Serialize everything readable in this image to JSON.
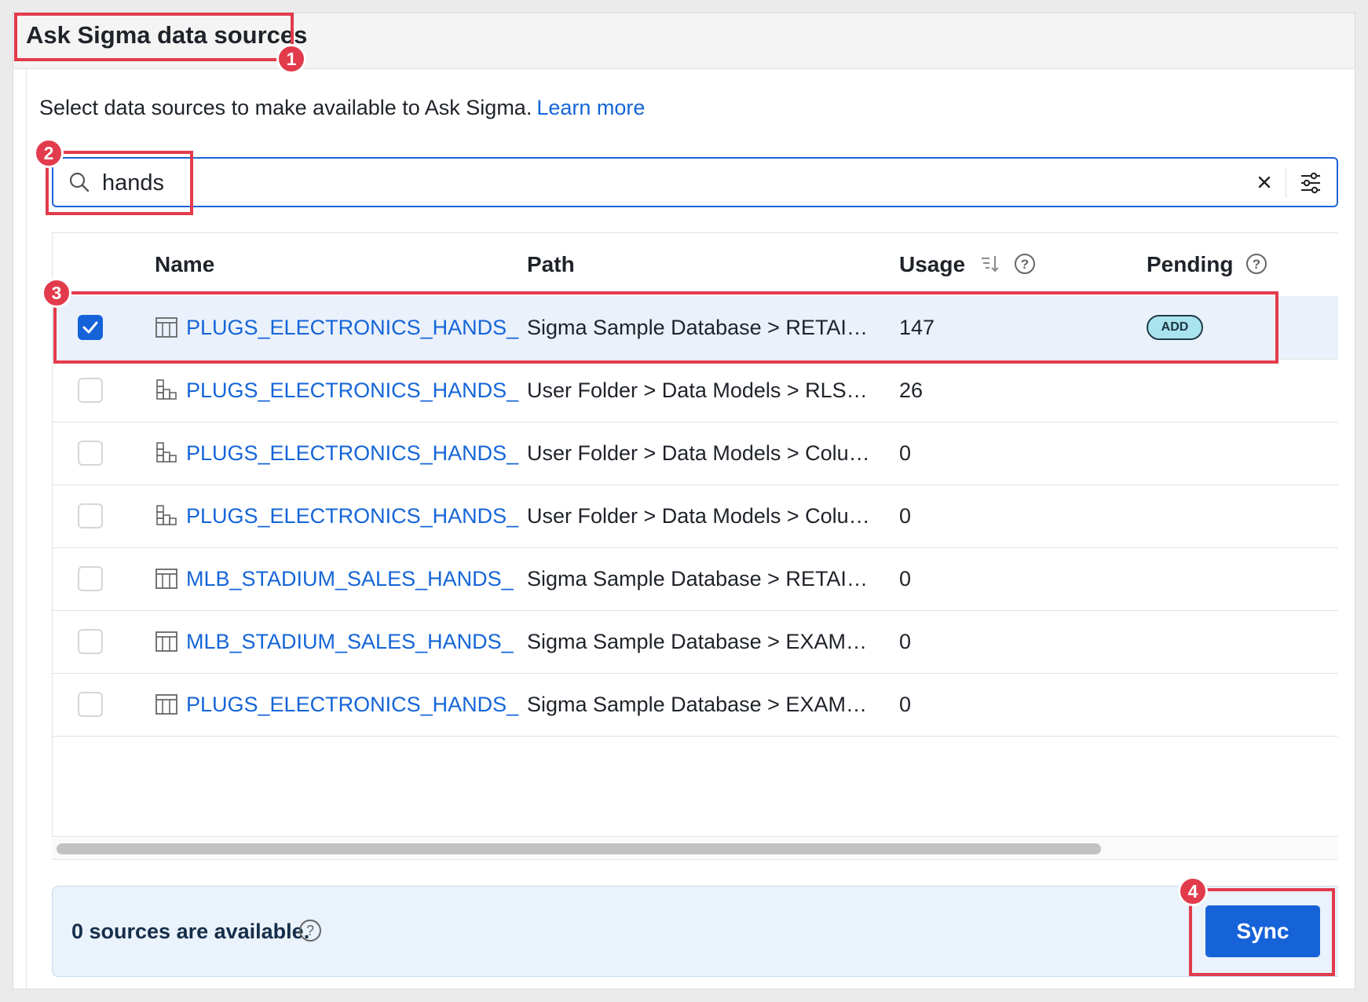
{
  "panel": {
    "title": "Ask Sigma data sources",
    "intro_text": "Select data sources to make available to Ask Sigma.",
    "learn_more": "Learn more"
  },
  "search": {
    "value": "hands",
    "icon": "search-icon",
    "clear_icon": "close-icon",
    "filter_icon": "sliders-icon"
  },
  "table": {
    "columns": {
      "name": "Name",
      "path": "Path",
      "usage": "Usage",
      "pending": "Pending"
    },
    "rows": [
      {
        "selected": true,
        "icon": "table-icon",
        "name": "PLUGS_ELECTRONICS_HANDS_",
        "path": "Sigma Sample Database > RETAI…",
        "usage": "147",
        "pending": "ADD"
      },
      {
        "selected": false,
        "icon": "data-model-icon",
        "name": "PLUGS_ELECTRONICS_HANDS_",
        "path": "User Folder > Data Models > RLS…",
        "usage": "26",
        "pending": ""
      },
      {
        "selected": false,
        "icon": "data-model-icon",
        "name": "PLUGS_ELECTRONICS_HANDS_",
        "path": "User Folder > Data Models > Colu…",
        "usage": "0",
        "pending": ""
      },
      {
        "selected": false,
        "icon": "data-model-icon",
        "name": "PLUGS_ELECTRONICS_HANDS_",
        "path": "User Folder > Data Models > Colu…",
        "usage": "0",
        "pending": ""
      },
      {
        "selected": false,
        "icon": "table-icon",
        "name": "MLB_STADIUM_SALES_HANDS_",
        "path": "Sigma Sample Database > RETAI…",
        "usage": "0",
        "pending": ""
      },
      {
        "selected": false,
        "icon": "table-icon",
        "name": "MLB_STADIUM_SALES_HANDS_",
        "path": "Sigma Sample Database > EXAM…",
        "usage": "0",
        "pending": ""
      },
      {
        "selected": false,
        "icon": "table-icon",
        "name": "PLUGS_ELECTRONICS_HANDS_",
        "path": "Sigma Sample Database > EXAM…",
        "usage": "0",
        "pending": ""
      }
    ]
  },
  "footer": {
    "status": "0 sources are available.",
    "sync_label": "Sync"
  },
  "callouts": [
    "1",
    "2",
    "3",
    "4"
  ],
  "colors": {
    "accent": "#1662d8",
    "link": "#1565d8",
    "callout": "#e23b4b",
    "selected_row": "#eaf1fb",
    "badge_fill": "#a8e3ee"
  }
}
